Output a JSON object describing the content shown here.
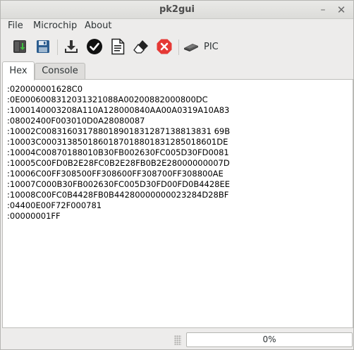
{
  "window": {
    "title": "pk2gui",
    "minimize_glyph": "–",
    "close_glyph": "✕"
  },
  "menu": {
    "file": "File",
    "microchip": "Microchip",
    "about": "About"
  },
  "toolbar": {
    "buttons": [
      {
        "icon": "open-book-icon"
      },
      {
        "icon": "save-floppy-icon"
      },
      {
        "icon": "download-icon"
      },
      {
        "icon": "verify-check-icon"
      },
      {
        "icon": "document-icon"
      },
      {
        "icon": "eraser-icon"
      },
      {
        "icon": "stop-error-icon"
      }
    ],
    "device_icon": "chip-programmer-icon",
    "device_label": "PIC"
  },
  "tabs": {
    "hex": "Hex",
    "console": "Console",
    "active": "Hex"
  },
  "hex": {
    "lines": [
      ":020000001628C0",
      ":0E0006008312031321088A00200882000800DC",
      ":1000140003208A110A128000840AA00A0319A10A83",
      ":08002400F003010D0A28080087",
      ":10002C008316031788018901831287138813831 69B",
      ":10003C0003138501860187018801831285018601DE",
      ":10004C00870188010B30FB002630FC005D30FD0081",
      ":10005C00FD0B2E28FC0B2E28FB0B2E28000000007D",
      ":10006C00FF308500FF308600FF308700FF308800AE",
      ":10007C000B30FB002630FC005D30FD00FD0B4428EE",
      ":10008C00FC0B4428FB0B44280000000023284D28BF",
      ":04400E00F72F000781",
      ":00000001FF"
    ]
  },
  "status": {
    "progress_percent": 0,
    "progress_text": "0%"
  },
  "colors": {
    "progress_fill": "#4a90d9",
    "stop_red": "#e53935",
    "download_arrow": "#333333"
  }
}
